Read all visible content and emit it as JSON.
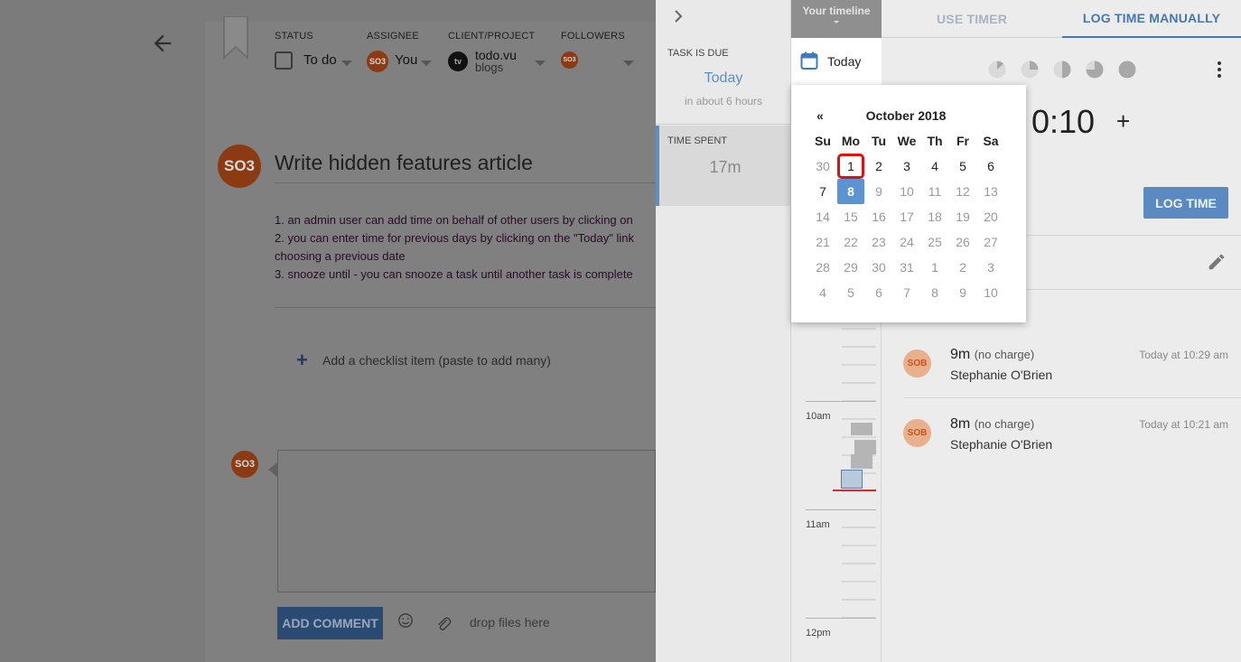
{
  "task": {
    "status_label": "STATUS",
    "status_value": "To do",
    "assignee_label": "ASSIGNEE",
    "assignee_avatar": "SO3",
    "assignee_value": "You",
    "client_label": "CLIENT/PROJECT",
    "client_badge": "tv",
    "client_name": "todo.vu",
    "project_name": "blogs",
    "followers_label": "FOLLOWERS",
    "followers_avatar": "SO3",
    "title_avatar": "SO3",
    "title": "Write hidden features article",
    "description": [
      "1. an admin user can add time on behalf of other users by clicking on",
      "2. you can enter time for previous days by clicking on the \"Today\" link",
      "choosing a previous date",
      "3. snooze until - you can snooze a task until another task is complete"
    ],
    "checklist_placeholder": "Add a checklist item (paste to add many)",
    "comment_avatar": "SO3",
    "add_comment_label": "ADD COMMENT",
    "drop_files_label": "drop files here"
  },
  "panel": {
    "due_label": "TASK IS DUE",
    "due_value": "Today",
    "due_sub": "in about 6 hours",
    "spent_label": "TIME SPENT",
    "spent_value": "17m",
    "timeline_tab": "Your timeline",
    "today_label": "Today",
    "hours": [
      "10am",
      "11am",
      "12pm"
    ],
    "tabs": {
      "timer": "USE TIMER",
      "manual": "LOG TIME MANUALLY"
    },
    "duration": "0:10",
    "plus": "+",
    "log_time_label": "LOG TIME",
    "entries": [
      {
        "avatar": "SOB",
        "duration": "9m",
        "charge": "(no charge)",
        "name": "Stephanie O'Brien",
        "time": "Today at 10:29 am"
      },
      {
        "avatar": "SOB",
        "duration": "8m",
        "charge": "(no charge)",
        "name": "Stephanie O'Brien",
        "time": "Today at 10:21 am"
      }
    ]
  },
  "datepicker": {
    "prev": "«",
    "month": "October 2018",
    "weekdays": [
      "Su",
      "Mo",
      "Tu",
      "We",
      "Th",
      "Fr",
      "Sa"
    ],
    "weeks": [
      [
        "30",
        "1",
        "2",
        "3",
        "4",
        "5",
        "6"
      ],
      [
        "7",
        "8",
        "9",
        "10",
        "11",
        "12",
        "13"
      ],
      [
        "14",
        "15",
        "16",
        "17",
        "18",
        "19",
        "20"
      ],
      [
        "21",
        "22",
        "23",
        "24",
        "25",
        "26",
        "27"
      ],
      [
        "28",
        "29",
        "30",
        "31",
        "1",
        "2",
        "3"
      ],
      [
        "4",
        "5",
        "6",
        "7",
        "8",
        "9",
        "10"
      ]
    ],
    "selected_day": "8",
    "highlighted_day": "1"
  },
  "colors": {
    "accent": "#4678ad",
    "selected": "#5b93d3",
    "highlight": "#e01010",
    "avatar": "#c9541e"
  }
}
